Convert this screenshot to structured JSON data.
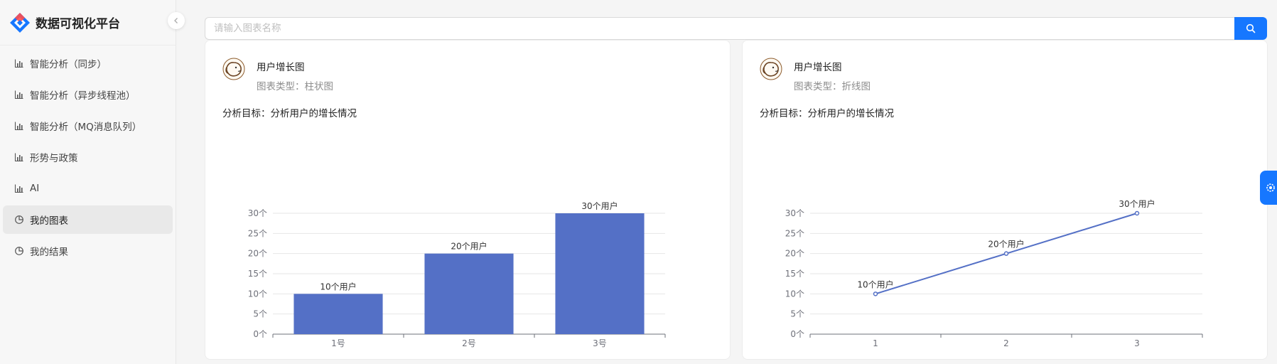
{
  "app": {
    "title": "数据可视化平台"
  },
  "sidebar": {
    "items": [
      {
        "label": "智能分析（同步）",
        "icon": "bar-chart-icon",
        "active": false
      },
      {
        "label": "智能分析（异步线程池）",
        "icon": "bar-chart-icon",
        "active": false
      },
      {
        "label": "智能分析（MQ消息队列）",
        "icon": "bar-chart-icon",
        "active": false
      },
      {
        "label": "形势与政策",
        "icon": "bar-chart-icon",
        "active": false
      },
      {
        "label": "AI",
        "icon": "bar-chart-icon",
        "active": false
      },
      {
        "label": "我的图表",
        "icon": "pie-chart-icon",
        "active": true
      },
      {
        "label": "我的结果",
        "icon": "pie-chart-icon",
        "active": false
      }
    ]
  },
  "search": {
    "placeholder": "请输入图表名称",
    "value": ""
  },
  "colors": {
    "accent": "#1677ff",
    "series": "#5470c6"
  },
  "cards": [
    {
      "title": "用户增长图",
      "type_text": "图表类型：柱状图",
      "goal_text": "分析目标：分析用户的增长情况"
    },
    {
      "title": "用户增长图",
      "type_text": "图表类型：折线图",
      "goal_text": "分析目标：分析用户的增长情况"
    }
  ],
  "chart_data": [
    {
      "type": "bar",
      "categories": [
        "1号",
        "2号",
        "3号"
      ],
      "values": [
        10,
        20,
        30
      ],
      "data_labels": [
        "10个用户",
        "20个用户",
        "30个用户"
      ],
      "ylim": [
        0,
        30
      ],
      "y_ticks": [
        "0个",
        "5个",
        "10个",
        "15个",
        "20个",
        "25个",
        "30个"
      ],
      "grid": true
    },
    {
      "type": "line",
      "categories": [
        "1",
        "2",
        "3"
      ],
      "values": [
        10,
        20,
        30
      ],
      "data_labels": [
        "10个用户",
        "20个用户",
        "30个用户"
      ],
      "ylim": [
        0,
        30
      ],
      "y_ticks": [
        "0个",
        "5个",
        "10个",
        "15个",
        "20个",
        "25个",
        "30个"
      ],
      "grid": true
    }
  ]
}
